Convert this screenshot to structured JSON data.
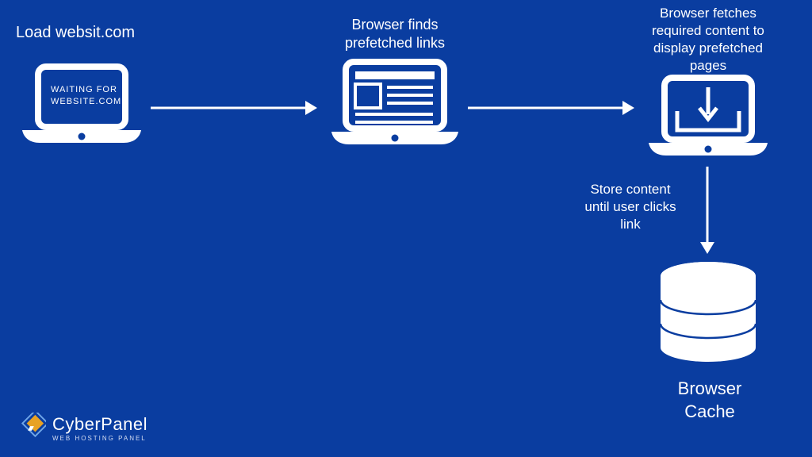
{
  "steps": {
    "step1_label": "Load websit.com",
    "step1_screen": "WAITING FOR\nWEBSITE.COM",
    "step2_label": "Browser finds\nprefetched links",
    "step3_label": "Browser fetches\nrequired content to\ndisplay prefetched\npages",
    "step4_side": "Store content\nuntil user clicks\nlink",
    "cache_label": "Browser\nCache"
  },
  "brand": {
    "name": "CyberPanel",
    "tag": "WEB HOSTING PANEL"
  },
  "colors": {
    "bg": "#0a3da0",
    "fg": "#ffffff",
    "logo_accent": "#f4a81d"
  }
}
